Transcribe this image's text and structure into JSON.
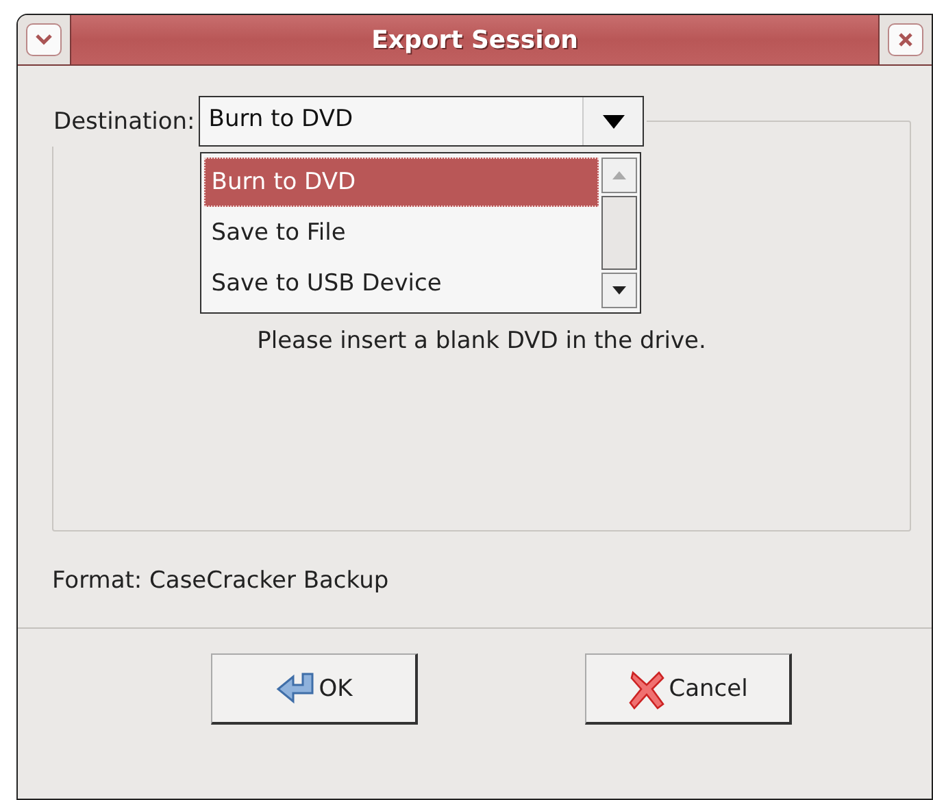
{
  "window": {
    "title": "Export Session"
  },
  "destination": {
    "label": "Destination:",
    "value": "Burn to DVD",
    "expanded": true,
    "options": [
      {
        "label": "Burn to DVD",
        "selected": true
      },
      {
        "label": "Save to File",
        "selected": false
      },
      {
        "label": "Save to USB Device",
        "selected": false
      }
    ]
  },
  "message": "Please insert a blank DVD in the drive.",
  "format": "Format: CaseCracker Backup",
  "buttons": [
    {
      "label": "OK",
      "kind": "ok"
    },
    {
      "label": "Cancel",
      "kind": "cancel"
    }
  ]
}
